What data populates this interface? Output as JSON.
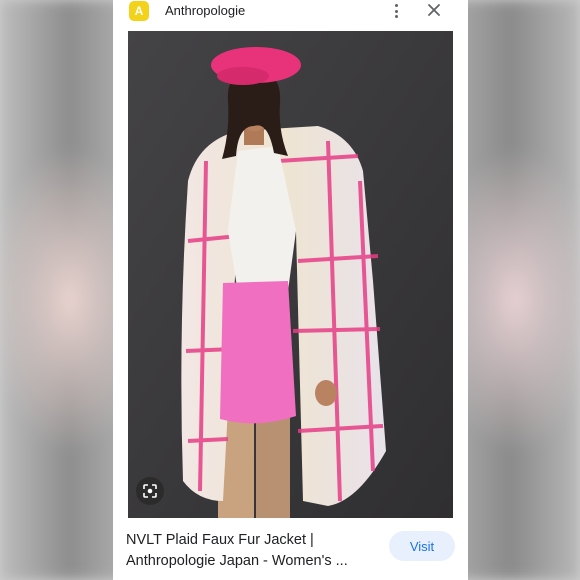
{
  "site": {
    "favicon_letter": "A",
    "name": "Anthropologie"
  },
  "icons": {
    "more": "more-vert-icon",
    "close": "close-icon",
    "lens": "google-lens-icon"
  },
  "result": {
    "title_line1": "NVLT Plaid Faux Fur Jacket |",
    "title_line2": "Anthropologie Japan - Women's ...",
    "visit_label": "Visit"
  },
  "colors": {
    "favicon": "#f3d21a",
    "visit_bg": "#e8f0fe",
    "visit_text": "#1a73e8",
    "photo_bg": "#3b3a3c",
    "beret": "#e8337a",
    "skirt": "#f06fc0"
  }
}
